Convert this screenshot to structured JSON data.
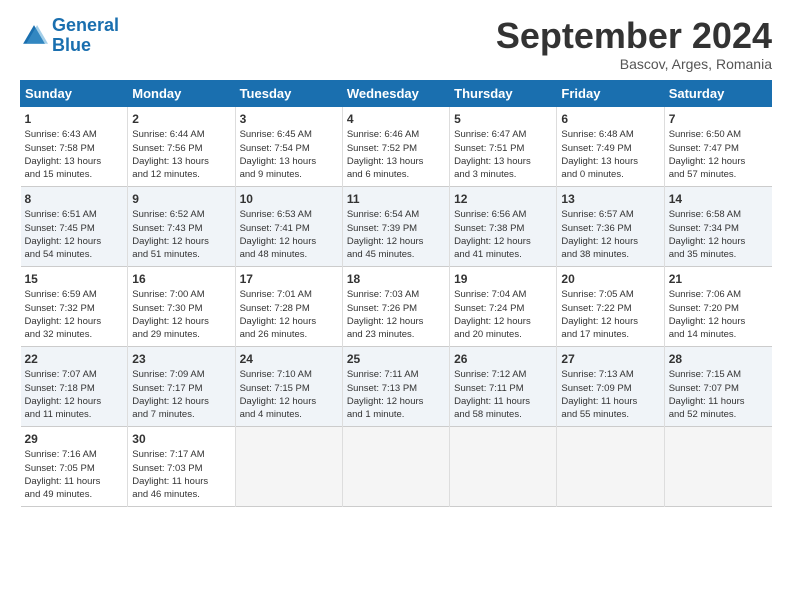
{
  "header": {
    "logo_line1": "General",
    "logo_line2": "Blue",
    "month": "September 2024",
    "location": "Bascov, Arges, Romania"
  },
  "days_of_week": [
    "Sunday",
    "Monday",
    "Tuesday",
    "Wednesday",
    "Thursday",
    "Friday",
    "Saturday"
  ],
  "weeks": [
    [
      {
        "day": "1",
        "lines": [
          "Sunrise: 6:43 AM",
          "Sunset: 7:58 PM",
          "Daylight: 13 hours",
          "and 15 minutes."
        ]
      },
      {
        "day": "2",
        "lines": [
          "Sunrise: 6:44 AM",
          "Sunset: 7:56 PM",
          "Daylight: 13 hours",
          "and 12 minutes."
        ]
      },
      {
        "day": "3",
        "lines": [
          "Sunrise: 6:45 AM",
          "Sunset: 7:54 PM",
          "Daylight: 13 hours",
          "and 9 minutes."
        ]
      },
      {
        "day": "4",
        "lines": [
          "Sunrise: 6:46 AM",
          "Sunset: 7:52 PM",
          "Daylight: 13 hours",
          "and 6 minutes."
        ]
      },
      {
        "day": "5",
        "lines": [
          "Sunrise: 6:47 AM",
          "Sunset: 7:51 PM",
          "Daylight: 13 hours",
          "and 3 minutes."
        ]
      },
      {
        "day": "6",
        "lines": [
          "Sunrise: 6:48 AM",
          "Sunset: 7:49 PM",
          "Daylight: 13 hours",
          "and 0 minutes."
        ]
      },
      {
        "day": "7",
        "lines": [
          "Sunrise: 6:50 AM",
          "Sunset: 7:47 PM",
          "Daylight: 12 hours",
          "and 57 minutes."
        ]
      }
    ],
    [
      {
        "day": "8",
        "lines": [
          "Sunrise: 6:51 AM",
          "Sunset: 7:45 PM",
          "Daylight: 12 hours",
          "and 54 minutes."
        ]
      },
      {
        "day": "9",
        "lines": [
          "Sunrise: 6:52 AM",
          "Sunset: 7:43 PM",
          "Daylight: 12 hours",
          "and 51 minutes."
        ]
      },
      {
        "day": "10",
        "lines": [
          "Sunrise: 6:53 AM",
          "Sunset: 7:41 PM",
          "Daylight: 12 hours",
          "and 48 minutes."
        ]
      },
      {
        "day": "11",
        "lines": [
          "Sunrise: 6:54 AM",
          "Sunset: 7:39 PM",
          "Daylight: 12 hours",
          "and 45 minutes."
        ]
      },
      {
        "day": "12",
        "lines": [
          "Sunrise: 6:56 AM",
          "Sunset: 7:38 PM",
          "Daylight: 12 hours",
          "and 41 minutes."
        ]
      },
      {
        "day": "13",
        "lines": [
          "Sunrise: 6:57 AM",
          "Sunset: 7:36 PM",
          "Daylight: 12 hours",
          "and 38 minutes."
        ]
      },
      {
        "day": "14",
        "lines": [
          "Sunrise: 6:58 AM",
          "Sunset: 7:34 PM",
          "Daylight: 12 hours",
          "and 35 minutes."
        ]
      }
    ],
    [
      {
        "day": "15",
        "lines": [
          "Sunrise: 6:59 AM",
          "Sunset: 7:32 PM",
          "Daylight: 12 hours",
          "and 32 minutes."
        ]
      },
      {
        "day": "16",
        "lines": [
          "Sunrise: 7:00 AM",
          "Sunset: 7:30 PM",
          "Daylight: 12 hours",
          "and 29 minutes."
        ]
      },
      {
        "day": "17",
        "lines": [
          "Sunrise: 7:01 AM",
          "Sunset: 7:28 PM",
          "Daylight: 12 hours",
          "and 26 minutes."
        ]
      },
      {
        "day": "18",
        "lines": [
          "Sunrise: 7:03 AM",
          "Sunset: 7:26 PM",
          "Daylight: 12 hours",
          "and 23 minutes."
        ]
      },
      {
        "day": "19",
        "lines": [
          "Sunrise: 7:04 AM",
          "Sunset: 7:24 PM",
          "Daylight: 12 hours",
          "and 20 minutes."
        ]
      },
      {
        "day": "20",
        "lines": [
          "Sunrise: 7:05 AM",
          "Sunset: 7:22 PM",
          "Daylight: 12 hours",
          "and 17 minutes."
        ]
      },
      {
        "day": "21",
        "lines": [
          "Sunrise: 7:06 AM",
          "Sunset: 7:20 PM",
          "Daylight: 12 hours",
          "and 14 minutes."
        ]
      }
    ],
    [
      {
        "day": "22",
        "lines": [
          "Sunrise: 7:07 AM",
          "Sunset: 7:18 PM",
          "Daylight: 12 hours",
          "and 11 minutes."
        ]
      },
      {
        "day": "23",
        "lines": [
          "Sunrise: 7:09 AM",
          "Sunset: 7:17 PM",
          "Daylight: 12 hours",
          "and 7 minutes."
        ]
      },
      {
        "day": "24",
        "lines": [
          "Sunrise: 7:10 AM",
          "Sunset: 7:15 PM",
          "Daylight: 12 hours",
          "and 4 minutes."
        ]
      },
      {
        "day": "25",
        "lines": [
          "Sunrise: 7:11 AM",
          "Sunset: 7:13 PM",
          "Daylight: 12 hours",
          "and 1 minute."
        ]
      },
      {
        "day": "26",
        "lines": [
          "Sunrise: 7:12 AM",
          "Sunset: 7:11 PM",
          "Daylight: 11 hours",
          "and 58 minutes."
        ]
      },
      {
        "day": "27",
        "lines": [
          "Sunrise: 7:13 AM",
          "Sunset: 7:09 PM",
          "Daylight: 11 hours",
          "and 55 minutes."
        ]
      },
      {
        "day": "28",
        "lines": [
          "Sunrise: 7:15 AM",
          "Sunset: 7:07 PM",
          "Daylight: 11 hours",
          "and 52 minutes."
        ]
      }
    ],
    [
      {
        "day": "29",
        "lines": [
          "Sunrise: 7:16 AM",
          "Sunset: 7:05 PM",
          "Daylight: 11 hours",
          "and 49 minutes."
        ]
      },
      {
        "day": "30",
        "lines": [
          "Sunrise: 7:17 AM",
          "Sunset: 7:03 PM",
          "Daylight: 11 hours",
          "and 46 minutes."
        ]
      },
      {
        "day": "",
        "lines": []
      },
      {
        "day": "",
        "lines": []
      },
      {
        "day": "",
        "lines": []
      },
      {
        "day": "",
        "lines": []
      },
      {
        "day": "",
        "lines": []
      }
    ]
  ]
}
